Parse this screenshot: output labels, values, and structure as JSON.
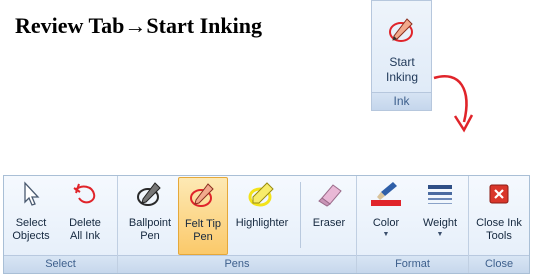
{
  "heading": {
    "before": "Review Tab",
    "arrow": "→",
    "after": "Start Inking"
  },
  "callout": {
    "button_label_line1": "Start",
    "button_label_line2": "Inking",
    "group_label": "Ink"
  },
  "ribbon": {
    "select": {
      "label": "Select",
      "select_objects_1": "Select",
      "select_objects_2": "Objects",
      "delete_all_ink_1": "Delete",
      "delete_all_ink_2": "All Ink"
    },
    "pens": {
      "label": "Pens",
      "ballpoint_1": "Ballpoint",
      "ballpoint_2": "Pen",
      "felttip_1": "Felt Tip",
      "felttip_2": "Pen",
      "highlighter": "Highlighter",
      "eraser": "Eraser"
    },
    "format": {
      "label": "Format",
      "color": "Color",
      "weight": "Weight",
      "dropdown_glyph": "▼"
    },
    "close": {
      "label": "Close",
      "close_ink_1": "Close Ink",
      "close_ink_2": "Tools"
    }
  },
  "colors": {
    "accent_red": "#e0242a",
    "selected_fill": "#fbc96a"
  }
}
